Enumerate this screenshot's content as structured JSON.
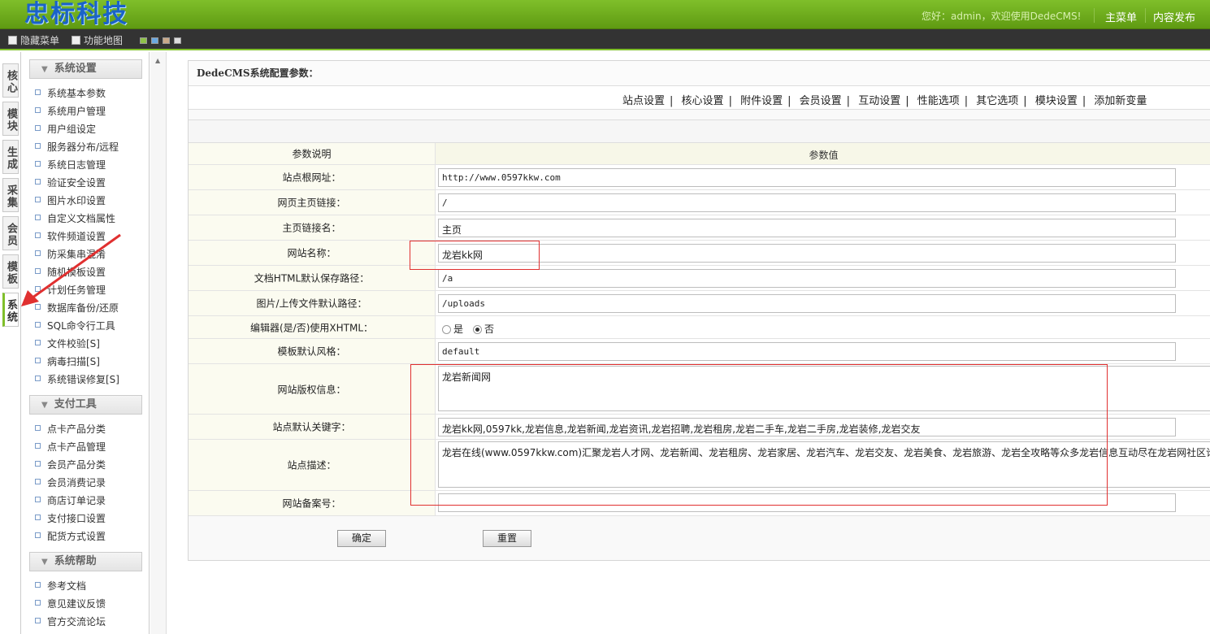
{
  "header": {
    "logo": "忠标科技",
    "welcome": "您好：admin，欢迎使用DedeCMS!",
    "nav": [
      "主菜单",
      "内容发布"
    ]
  },
  "toolbar": {
    "hide_menu": "隐藏菜单",
    "site_map": "功能地图",
    "skin_colors": [
      "#8fc24a",
      "#6aa8e0",
      "#c9a989",
      "#dddddd"
    ]
  },
  "vtabs": [
    "核心",
    "模块",
    "生成",
    "采集",
    "会员",
    "模板",
    "系统"
  ],
  "leftmenu": {
    "groups": [
      {
        "title": "系统设置",
        "items": [
          "系统基本参数",
          "系统用户管理",
          "用户组设定",
          "服务器分布/远程",
          "系统日志管理",
          "验证安全设置",
          "图片水印设置",
          "自定义文档属性",
          "软件频道设置",
          "防采集串混淆",
          "随机模板设置",
          "计划任务管理",
          "数据库备份/还原",
          "SQL命令行工具",
          "文件校验[S]",
          "病毒扫描[S]",
          "系统错误修复[S]"
        ]
      },
      {
        "title": "支付工具",
        "items": [
          "点卡产品分类",
          "点卡产品管理",
          "会员产品分类",
          "会员消费记录",
          "商店订单记录",
          "支付接口设置",
          "配货方式设置"
        ]
      },
      {
        "title": "系统帮助",
        "items": [
          "参考文档",
          "意见建议反馈",
          "官方交流论坛"
        ]
      }
    ]
  },
  "main": {
    "title": "DedeCMS系统配置参数：",
    "tabs": [
      "站点设置",
      "核心设置",
      "附件设置",
      "会员设置",
      "互动设置",
      "性能选项",
      "其它选项",
      "模块设置",
      "添加新变量"
    ],
    "col_label": "参数说明",
    "col_value": "参数值",
    "fields": {
      "site_url": {
        "label": "站点根网址：",
        "value": "http://www.0597kkw.com"
      },
      "index_url": {
        "label": "网页主页链接：",
        "value": "/"
      },
      "index_name": {
        "label": "主页链接名：",
        "value": "主页"
      },
      "site_name": {
        "label": "网站名称：",
        "value": "龙岩kk网"
      },
      "html_path": {
        "label": "文档HTML默认保存路径：",
        "value": "/a"
      },
      "upload_path": {
        "label": "图片/上传文件默认路径：",
        "value": "/uploads"
      },
      "xhtml": {
        "label": "编辑器(是/否)使用XHTML：",
        "opt_yes": "是",
        "opt_no": "否",
        "selected": "否"
      },
      "template_style": {
        "label": "模板默认风格：",
        "value": "default"
      },
      "copyright": {
        "label": "网站版权信息：",
        "value": "龙岩新闻网"
      },
      "keywords": {
        "label": "站点默认关键字：",
        "value": "龙岩kk网,0597kk,龙岩信息,龙岩新闻,龙岩资讯,龙岩招聘,龙岩租房,龙岩二手车,龙岩二手房,龙岩装修,龙岩交友"
      },
      "description": {
        "label": "站点描述：",
        "value": "龙岩在线(www.0597kkw.com)汇聚龙岩人才网、龙岩新闻、龙岩租房、龙岩家居、龙岩汽车、龙岩交友、龙岩美食、龙岩旅游、龙岩全攻略等众多龙岩信息互动尽在龙岩网社区论坛"
      },
      "icp": {
        "label": "网站备案号：",
        "value": ""
      }
    },
    "submit": "确定",
    "reset": "重置"
  }
}
